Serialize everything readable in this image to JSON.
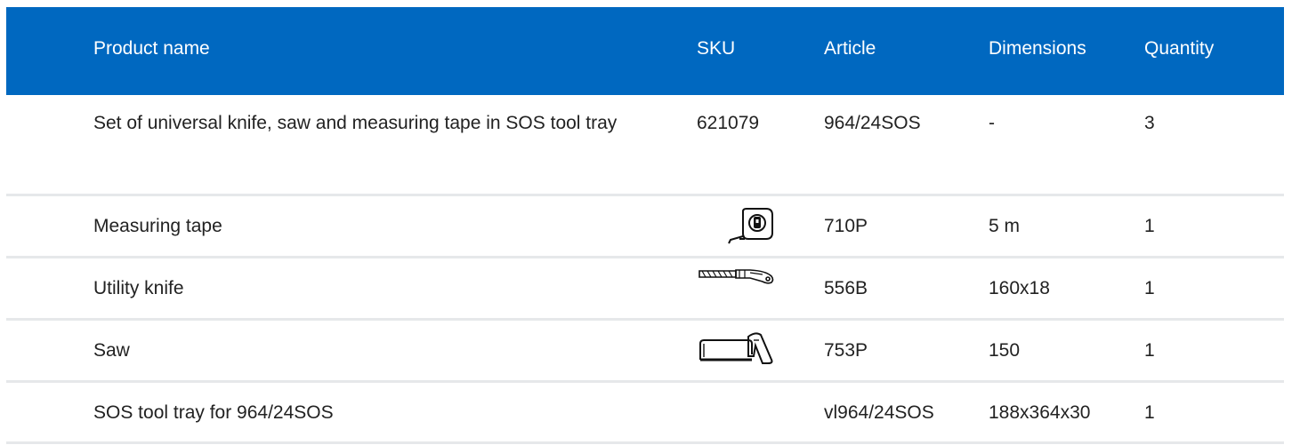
{
  "header": {
    "product_name": "Product name",
    "sku": "SKU",
    "article": "Article",
    "dimensions": "Dimensions",
    "quantity": "Quantity"
  },
  "rows": [
    {
      "product_name": "Set of universal knife, saw and measuring tape in SOS tool tray",
      "sku": "621079",
      "article": "964/24SOS",
      "dimensions": "-",
      "quantity": "3"
    },
    {
      "product_name": "Measuring tape",
      "sku_icon": "measuring-tape-icon",
      "article": "710P",
      "dimensions": "5 m",
      "quantity": "1"
    },
    {
      "product_name": "Utility knife",
      "sku_icon": "utility-knife-icon",
      "article": "556B",
      "dimensions": "160x18",
      "quantity": "1"
    },
    {
      "product_name": "Saw",
      "sku_icon": "hacksaw-icon",
      "article": "753P",
      "dimensions": "150",
      "quantity": "1"
    },
    {
      "product_name": "SOS tool tray for 964/24SOS",
      "article": "vl964/24SOS",
      "dimensions": "188x364x30",
      "quantity": "1"
    }
  ],
  "colors": {
    "header_background": "#0068c0",
    "header_text": "#ffffff",
    "body_text": "#222222",
    "row_divider": "#e6e8ea"
  }
}
